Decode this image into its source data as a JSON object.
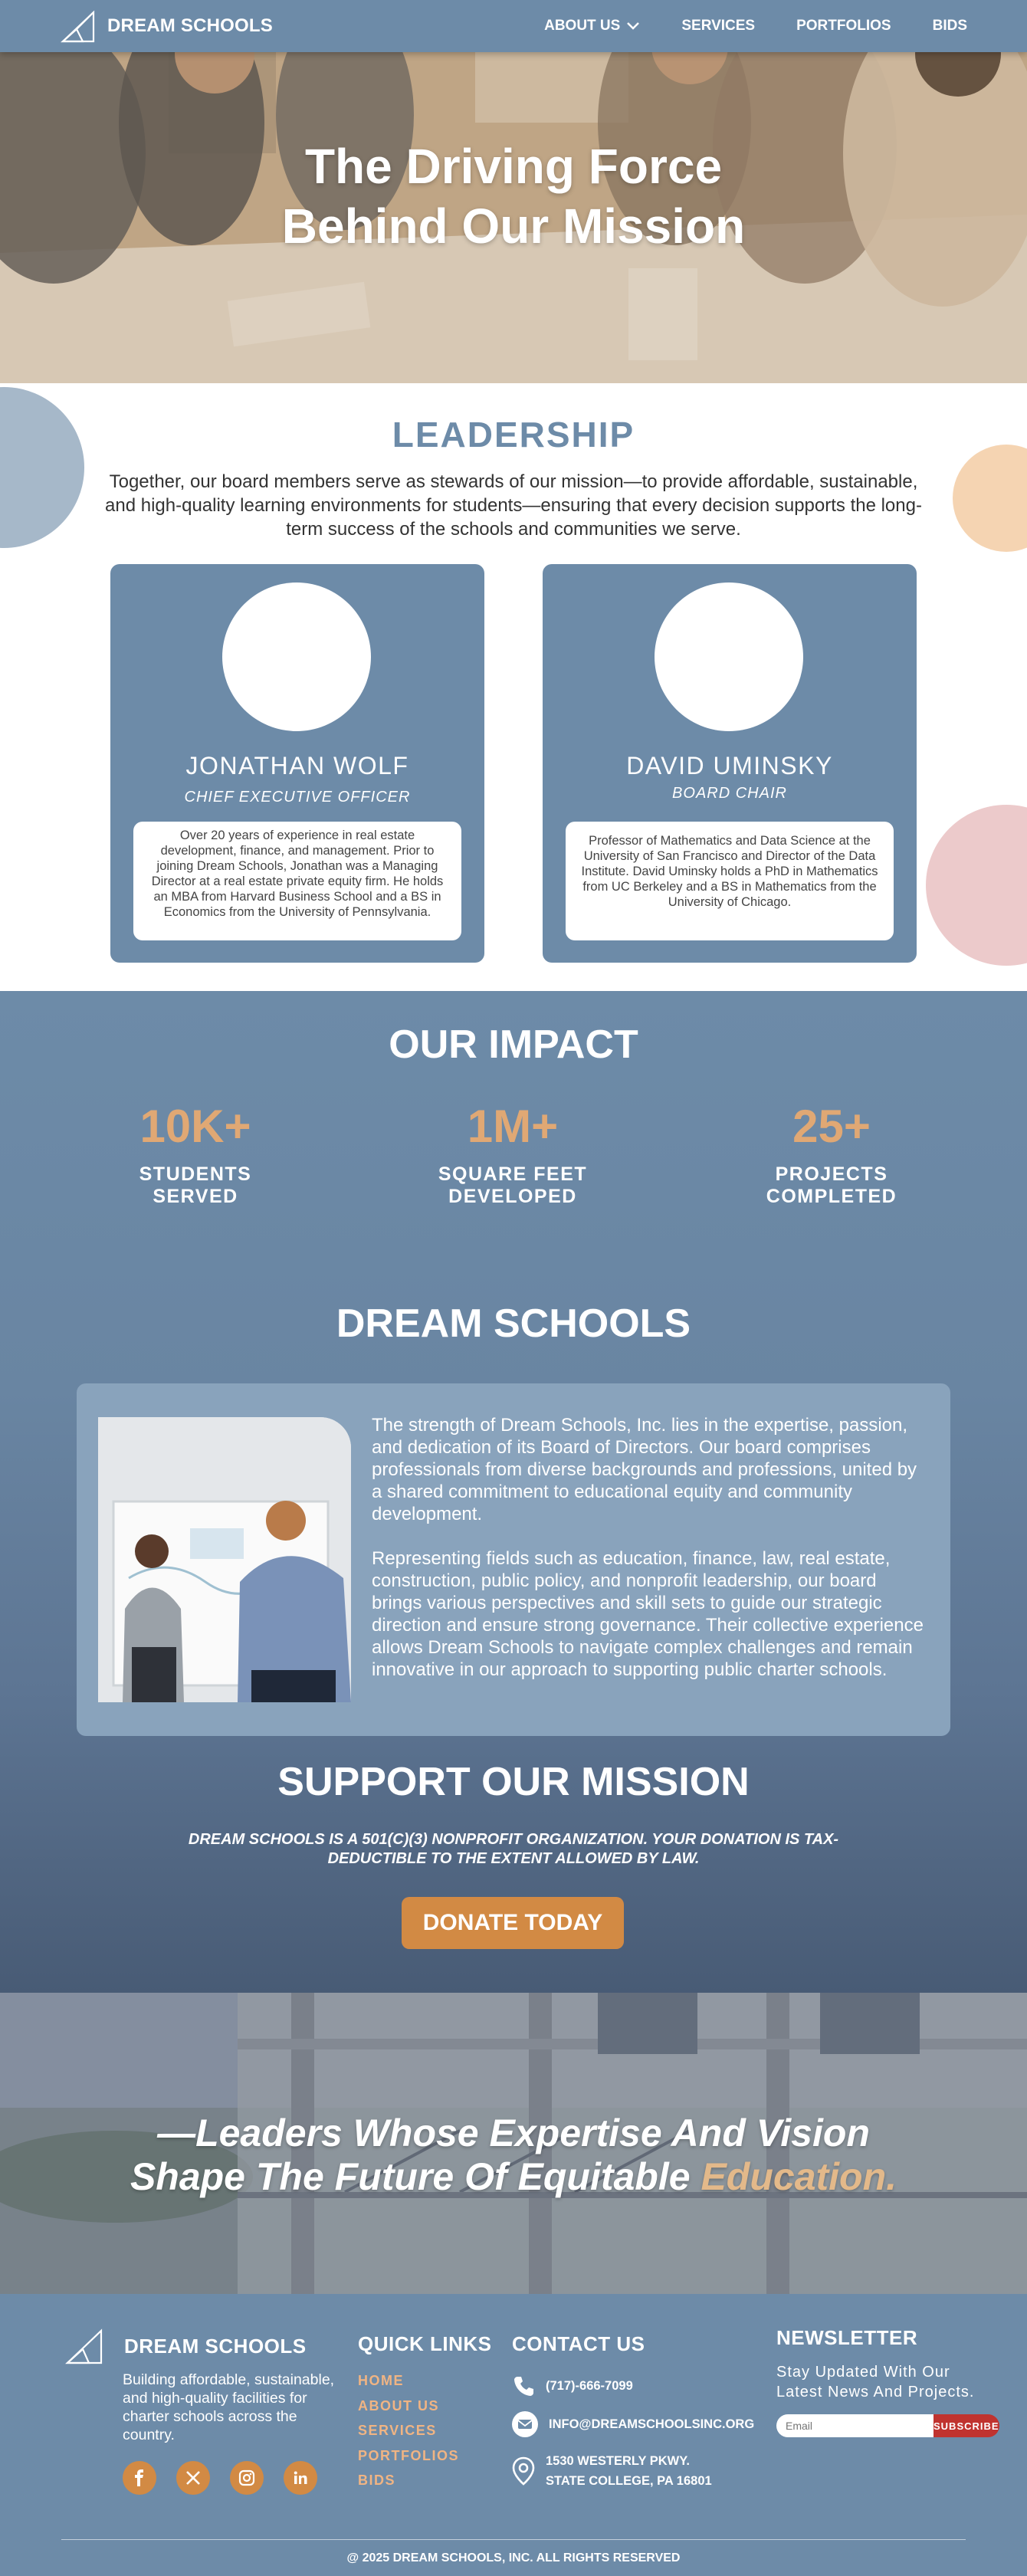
{
  "nav": {
    "brand": "DREAM SCHOOLS",
    "links": [
      "ABOUT US",
      "SERVICES",
      "PORTFOLIOS",
      "BIDS"
    ]
  },
  "hero": {
    "title_line1": "The Driving Force",
    "title_line2": "Behind Our Mission"
  },
  "leadership": {
    "title": "LEADERSHIP",
    "intro": "Together, our board members serve as stewards of our mission—to provide affordable, sustainable, and high-quality learning environments for students—ensuring that every decision supports the long-term success of the schools and communities we serve.",
    "members": [
      {
        "name": "JONATHAN WOLF",
        "role": "CHIEF EXECUTIVE OFFICER",
        "bio": "Over 20 years of experience in real estate development, finance, and management. Prior to joining Dream Schools, Jonathan was a Managing Director at a real estate private equity firm. He holds an MBA from Harvard Business School and a BS in Economics from the University of Pennsylvania."
      },
      {
        "name": "DAVID UMINSKY",
        "role": "BOARD CHAIR",
        "bio": "Professor of Mathematics and Data Science at the University of San Francisco and Director of the Data Institute. David Uminsky holds a PhD in Mathematics from UC Berkeley and a BS in Mathematics from the University of Chicago."
      }
    ]
  },
  "impact": {
    "title": "OUR IMPACT",
    "stats": [
      {
        "value": "10K+",
        "label_line1": "STUDENTS",
        "label_line2": "SERVED"
      },
      {
        "value": "1M+",
        "label_line1": "SQUARE FEET",
        "label_line2": "DEVELOPED"
      },
      {
        "value": "25+",
        "label_line1": "PROJECTS",
        "label_line2": "COMPLETED"
      }
    ]
  },
  "about": {
    "title": "DREAM SCHOOLS",
    "para1": "The strength of Dream Schools, Inc. lies in the expertise, passion, and dedication of its Board of Directors. Our board comprises professionals from diverse backgrounds and professions, united by a shared commitment to educational equity and community development.",
    "para2": "Representing fields such as education, finance, law, real estate, construction, public policy, and nonprofit leadership, our board brings various perspectives and skill sets to guide our strategic direction and ensure strong governance. Their collective experience allows Dream Schools to navigate complex challenges and remain innovative in our approach to supporting public charter schools."
  },
  "support": {
    "title": "SUPPORT OUR MISSION",
    "note": "DREAM SCHOOLS IS A 501(C)(3) NONPROFIT ORGANIZATION. YOUR DONATION IS TAX-DEDUCTIBLE TO THE EXTENT ALLOWED BY LAW.",
    "button": "DONATE TODAY"
  },
  "quote": {
    "line1": "—Leaders Whose Expertise And Vision",
    "line2_main": "Shape The Future Of Equitable ",
    "line2_accent": "Education",
    "line2_end": "."
  },
  "footer": {
    "brand": "DREAM SCHOOLS",
    "description": "Building affordable, sustainable, and high-quality facilities for charter schools across the country.",
    "quick_links_title": "QUICK LINKS",
    "quick_links": [
      "HOME",
      "ABOUT US",
      "SERVICES",
      "PORTFOLIOS",
      "BIDS"
    ],
    "contact_title": "CONTACT US",
    "phone": "(717)-666-7099",
    "email": "INFO@DREAMSCHOOLSINC.ORG",
    "address_line1": "1530 WESTERLY PKWY.",
    "address_line2": "STATE COLLEGE, PA 16801",
    "newsletter_title": "NEWSLETTER",
    "newsletter_desc": "Stay Updated With Our Latest News And Projects.",
    "newsletter_placeholder": "Email",
    "newsletter_button": "SUBSCRIBE",
    "copyright": "@ 2025 DREAM SCHOOLS, INC. ALL RIGHTS RESERVED"
  },
  "colors": {
    "primary": "#6d8ba8",
    "accent": "#d28a44",
    "stat": "#e0a874",
    "subscribe": "#c0332f"
  }
}
